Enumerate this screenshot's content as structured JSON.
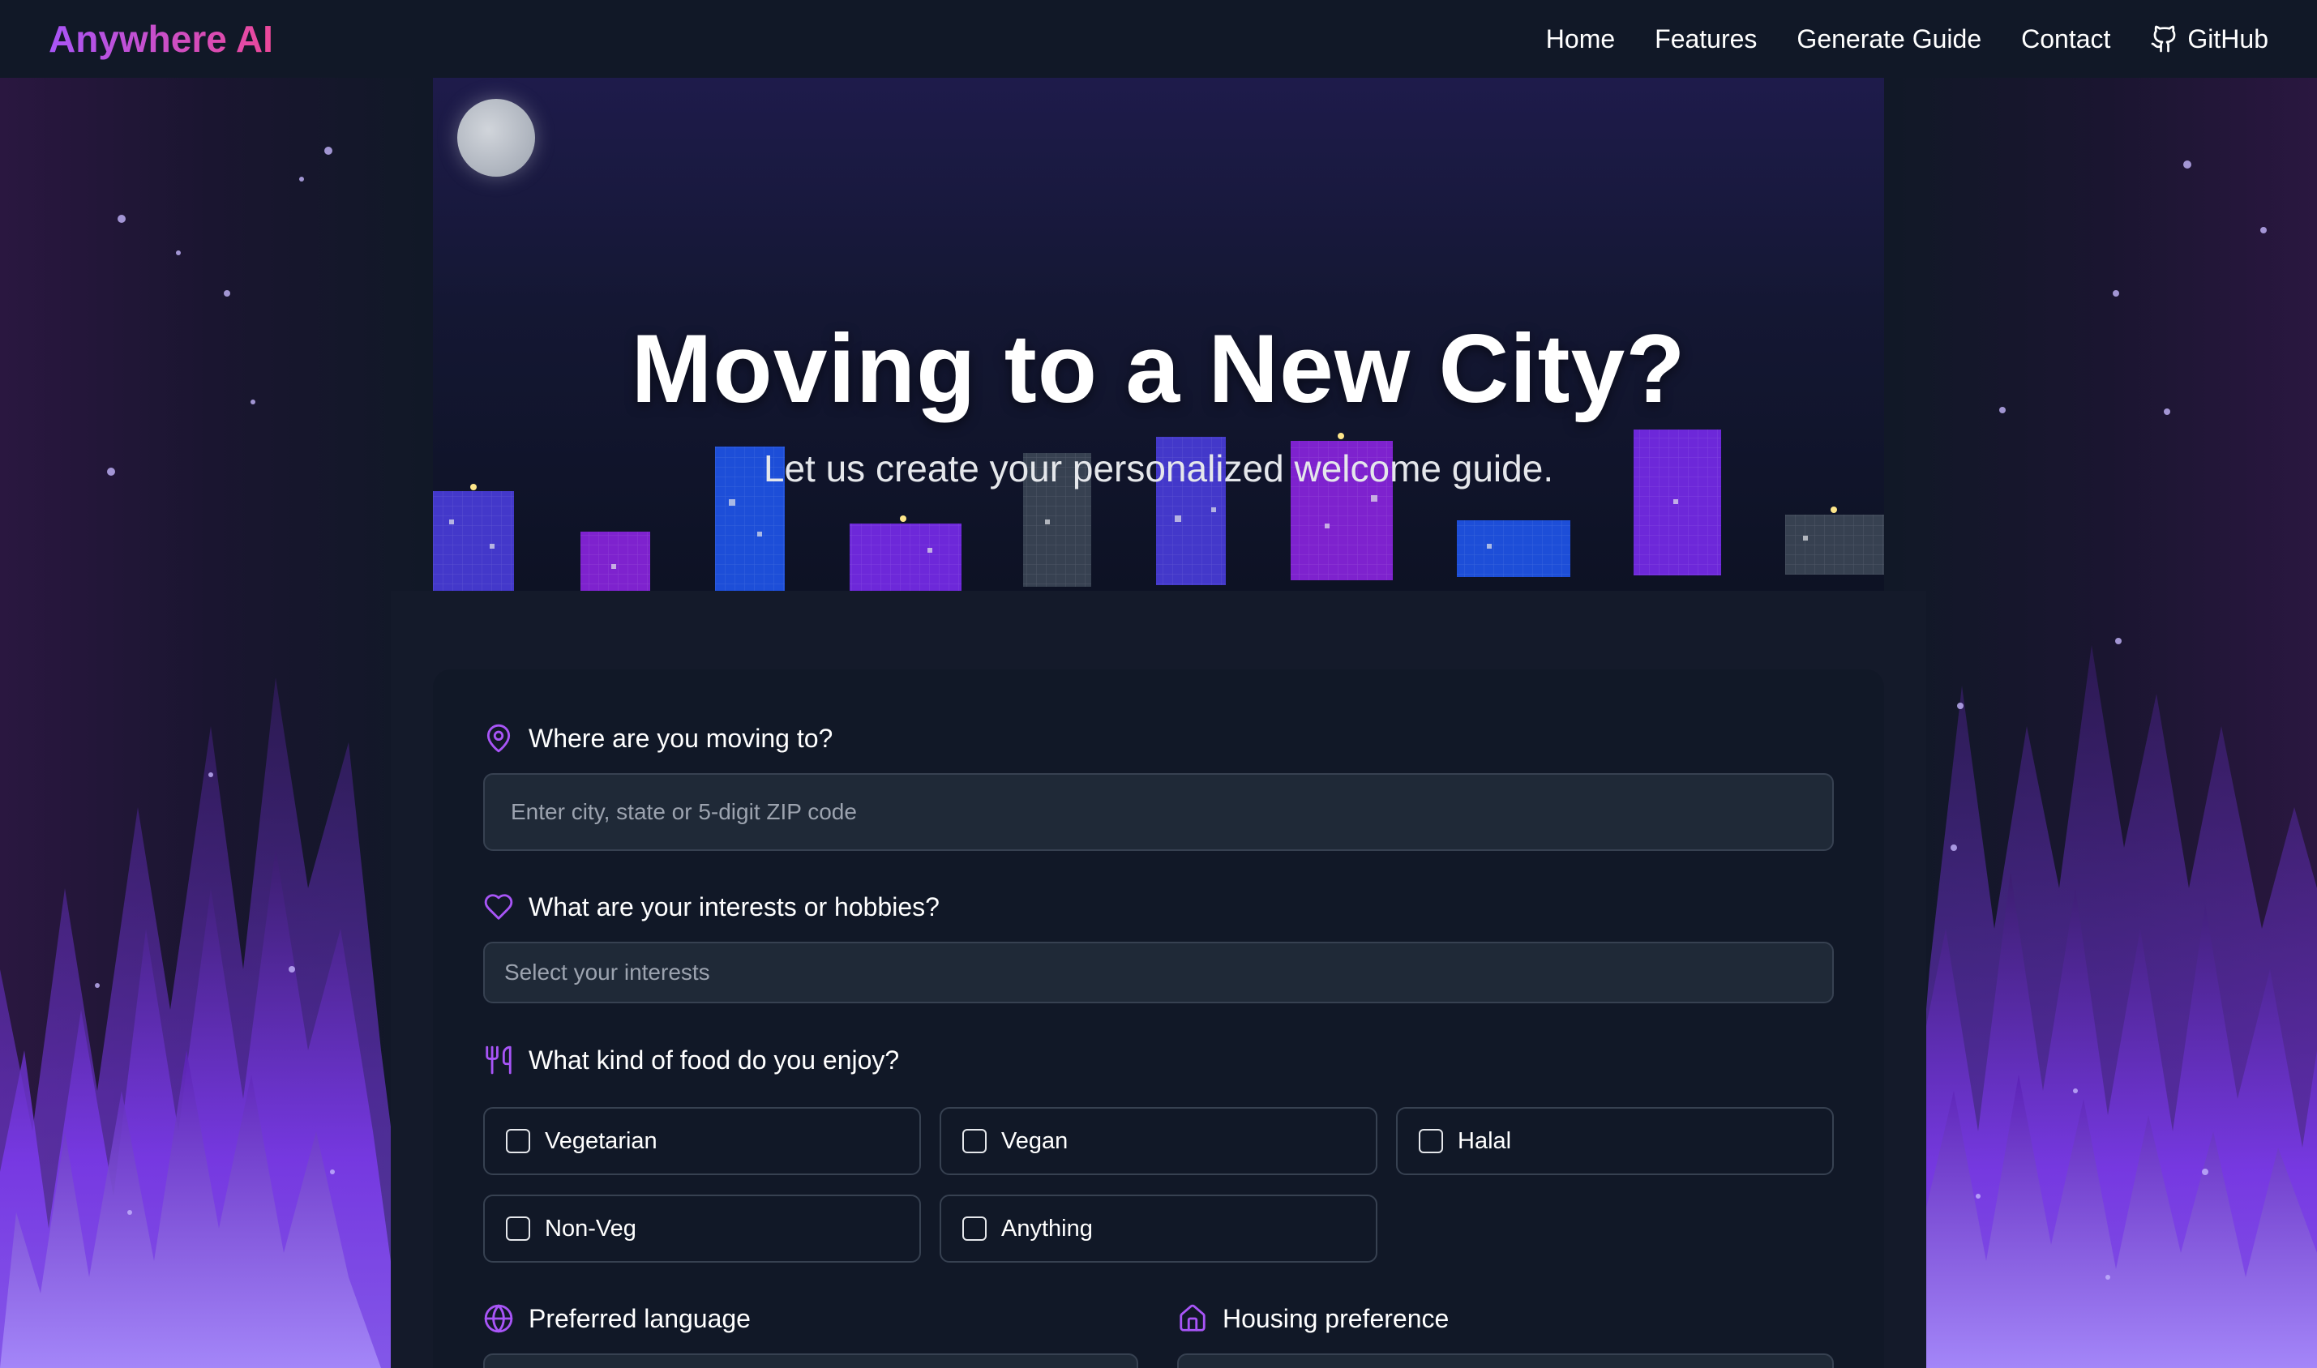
{
  "nav": {
    "brand": "Anywhere AI",
    "links": [
      "Home",
      "Features",
      "Generate Guide",
      "Contact",
      "GitHub"
    ]
  },
  "hero": {
    "title": "Moving to a New City?",
    "subtitle": "Let us create your personalized welcome guide."
  },
  "form": {
    "location": {
      "label": "Where are you moving to?",
      "placeholder": "Enter city, state or 5-digit ZIP code",
      "icon": "map-pin-icon"
    },
    "interests": {
      "label": "What are your interests or hobbies?",
      "placeholder": "Select your interests",
      "icon": "heart-icon"
    },
    "food": {
      "label": "What kind of food do you enjoy?",
      "icon": "utensils-icon",
      "options": [
        "Vegetarian",
        "Vegan",
        "Halal",
        "Non-Veg",
        "Anything"
      ]
    },
    "language": {
      "label": "Preferred language",
      "icon": "globe-icon"
    },
    "housing": {
      "label": "Housing preference",
      "icon": "home-icon"
    }
  },
  "colors": {
    "accent": "#a855f7",
    "brand_gradient_end": "#ec4899",
    "background": "#111827",
    "input_bg": "#1f2937"
  }
}
